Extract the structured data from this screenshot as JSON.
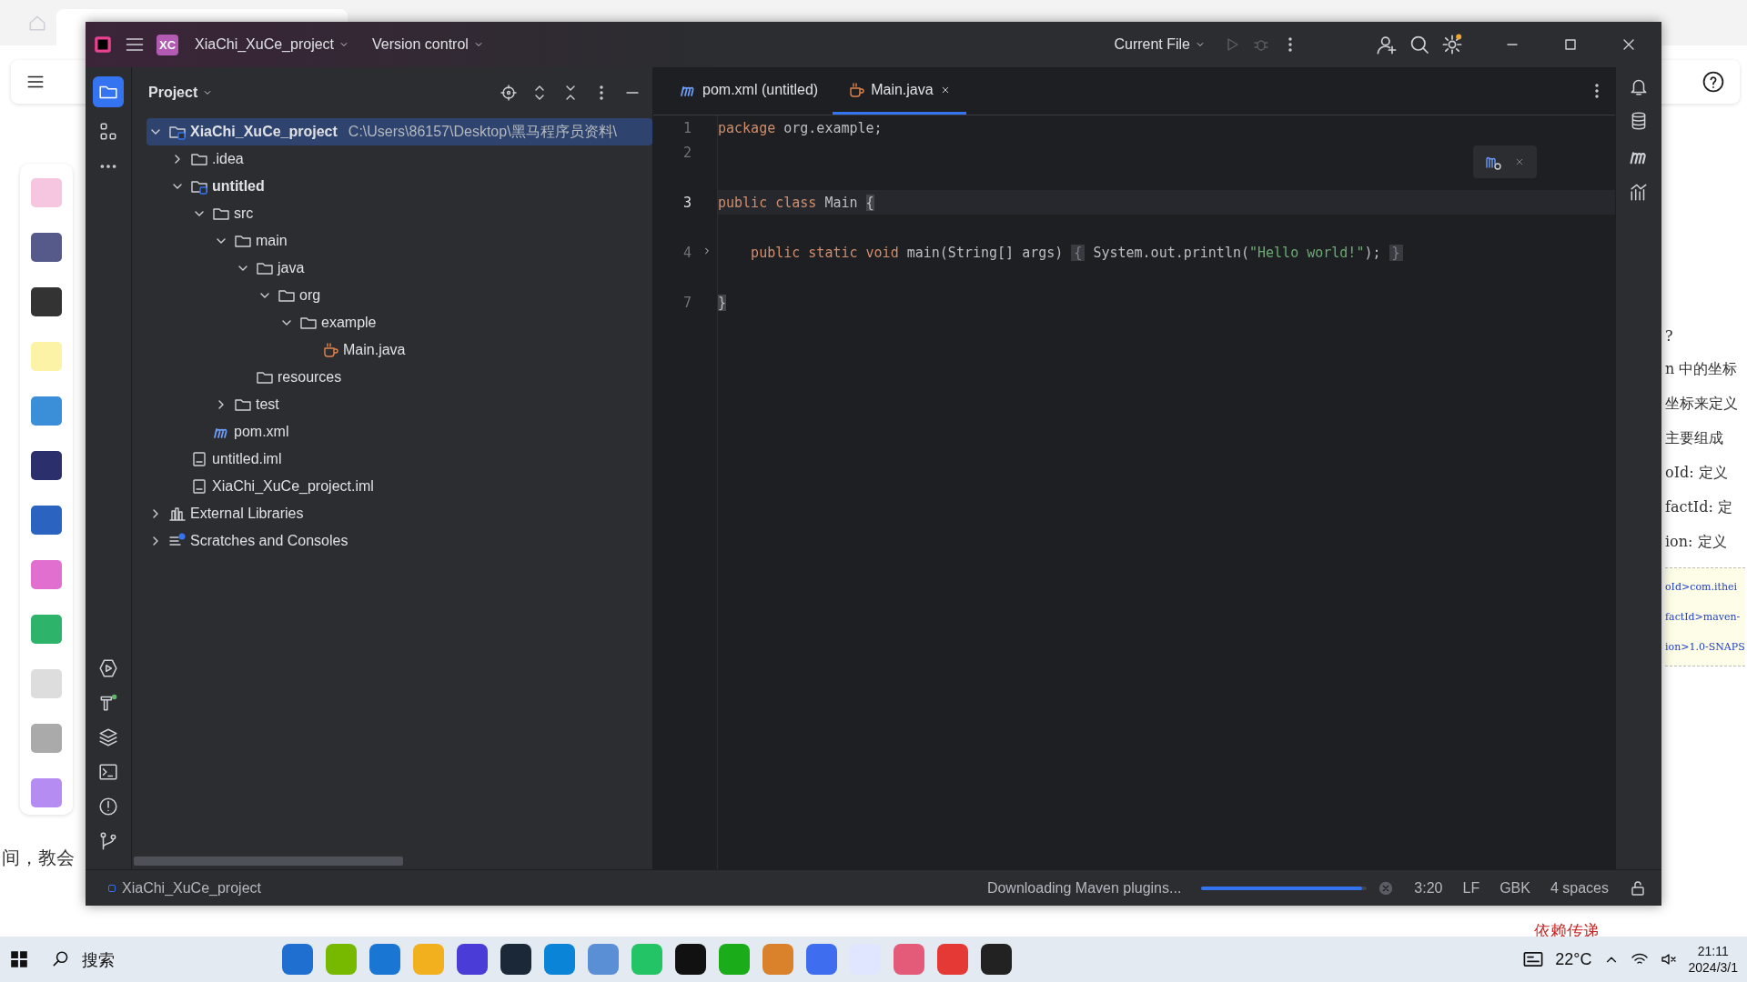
{
  "background": {
    "doc_lines": [
      "?",
      "n 中的坐标",
      "坐标来定义",
      "主要组成",
      "oId: 定义",
      "factId: 定",
      "ion: 定义"
    ],
    "code_lines": [
      "oId>com.ithei",
      "factId>maven-",
      "ion>1.0-SNAPS"
    ],
    "left_text": "间，教会",
    "bottom_heading": "依赖传递"
  },
  "window": {
    "badge": "XC",
    "project": "XiaChi_XuCe_project",
    "vcs": "Version control",
    "run_config": "Current File"
  },
  "project_panel": {
    "title": "Project",
    "tree": [
      {
        "kind": "module",
        "label": "XiaChi_XuCe_project",
        "path": "C:\\Users\\86157\\Desktop\\黑马程序员资料\\",
        "expanded": true,
        "selected": true,
        "children": [
          {
            "kind": "folder",
            "label": ".idea",
            "expanded": false,
            "selected": false
          },
          {
            "kind": "module",
            "label": "untitled",
            "expanded": true,
            "selected": false,
            "children": [
              {
                "kind": "folder",
                "label": "src",
                "expanded": true,
                "selected": false,
                "children": [
                  {
                    "kind": "folder",
                    "label": "main",
                    "expanded": true,
                    "selected": false,
                    "children": [
                      {
                        "kind": "folder",
                        "label": "java",
                        "expanded": true,
                        "selected": false,
                        "children": [
                          {
                            "kind": "folder",
                            "label": "org",
                            "expanded": true,
                            "selected": false,
                            "children": [
                              {
                                "kind": "folder",
                                "label": "example",
                                "expanded": true,
                                "selected": false,
                                "children": [
                                  {
                                    "kind": "java",
                                    "label": "Main.java",
                                    "selected": false
                                  }
                                ]
                              }
                            ]
                          }
                        ]
                      },
                      {
                        "kind": "folder",
                        "label": "resources",
                        "selected": false
                      }
                    ]
                  },
                  {
                    "kind": "folder",
                    "label": "test",
                    "expanded": false,
                    "selected": false
                  }
                ]
              },
              {
                "kind": "maven",
                "label": "pom.xml",
                "selected": false
              }
            ]
          },
          {
            "kind": "iml",
            "label": "untitled.iml",
            "selected": false
          },
          {
            "kind": "iml",
            "label": "XiaChi_XuCe_project.iml",
            "selected": false
          }
        ]
      },
      {
        "kind": "libraries",
        "label": "External Libraries",
        "expanded": false,
        "selected": false
      },
      {
        "kind": "scratches",
        "label": "Scratches and Consoles",
        "expanded": false,
        "selected": false
      }
    ]
  },
  "editor": {
    "tabs": [
      {
        "kind": "maven",
        "label": "pom.xml (untitled)",
        "selected": false
      },
      {
        "kind": "java",
        "label": "Main.java",
        "selected": true
      }
    ],
    "lines": [
      {
        "number": "1",
        "current": false,
        "tokens": [
          {
            "kind": "keyword",
            "text": "package"
          },
          {
            "kind": "plain",
            "text": " org.example;"
          }
        ]
      },
      {
        "number": "2",
        "current": false
      },
      {
        "number": "3",
        "current": true,
        "tokens": [
          {
            "kind": "keyword",
            "text": "public class"
          },
          {
            "kind": "plain",
            "text": " Main "
          },
          {
            "kind": "brace",
            "text": "{"
          }
        ]
      },
      {
        "number": "4",
        "current": false,
        "foldable": true,
        "tokens": [
          {
            "kind": "keyword",
            "text": "    public static void"
          },
          {
            "kind": "plain",
            "text": " main(String[] args) "
          },
          {
            "kind": "fold",
            "text": "{"
          },
          {
            "kind": "plain",
            "text": " System.out.println("
          },
          {
            "kind": "string",
            "text": "\"Hello world!\""
          },
          {
            "kind": "plain",
            "text": "); "
          },
          {
            "kind": "fold",
            "text": "}"
          }
        ]
      },
      {
        "number": "7",
        "current": false,
        "tokens": [
          {
            "kind": "brace",
            "text": "}"
          }
        ]
      }
    ]
  },
  "status_bar": {
    "project": "XiaChi_XuCe_project",
    "task": "Downloading Maven plugins...",
    "level": 0.97,
    "position": "3:20",
    "line_ending": "LF",
    "encoding": "GBK",
    "indent": "4 spaces"
  },
  "taskbar": {
    "search_placeholder": "搜索",
    "weather": "22°C",
    "time": "21:11",
    "date": "2024/3/1"
  }
}
